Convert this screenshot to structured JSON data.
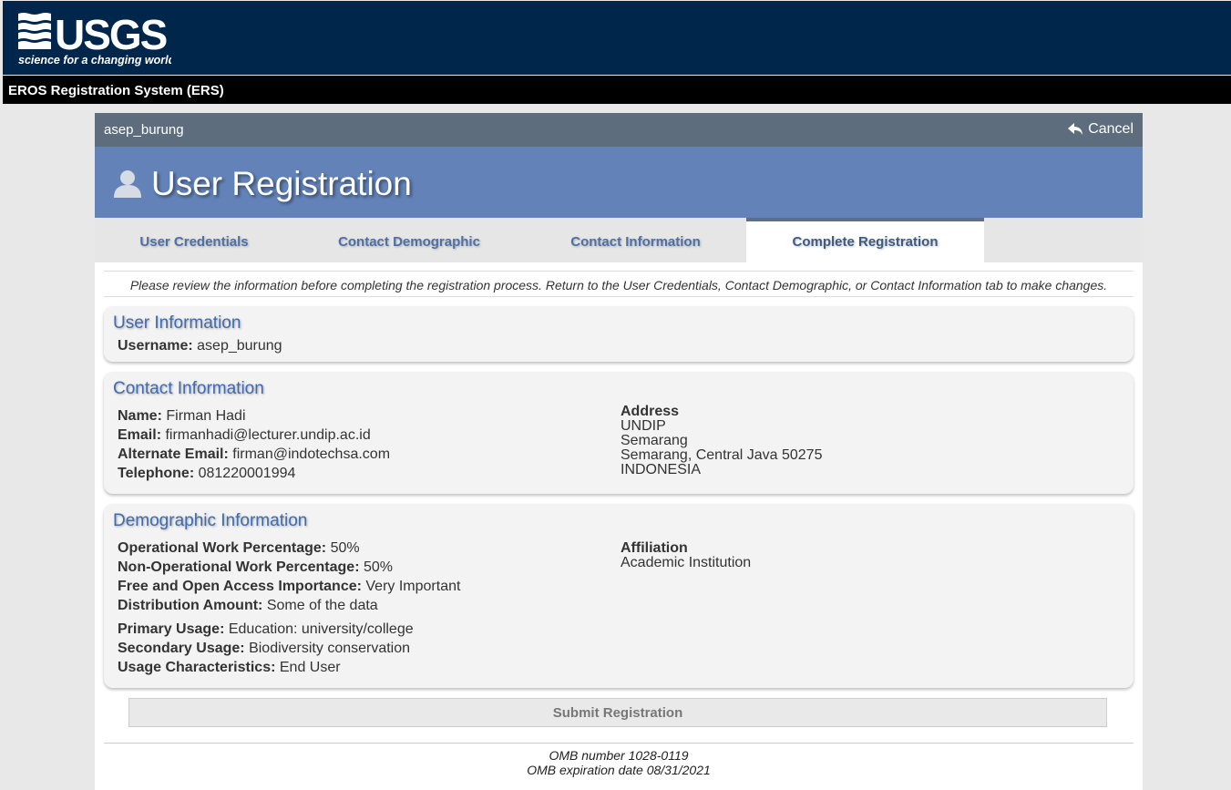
{
  "header": {
    "logo_text": "USGS",
    "logo_tagline": "science for a changing world",
    "system_name": "EROS Registration System (ERS)"
  },
  "user_strip": {
    "username": "asep_burung",
    "cancel_label": "Cancel"
  },
  "page_title": "User Registration",
  "tabs": [
    {
      "label": "User Credentials"
    },
    {
      "label": "Contact Demographic"
    },
    {
      "label": "Contact Information"
    },
    {
      "label": "Complete Registration"
    }
  ],
  "notice": "Please review the information before completing the registration process. Return to the User Credentials, Contact Demographic, or Contact Information tab to make changes.",
  "user_info": {
    "title": "User Information",
    "username_label": "Username:",
    "username": "asep_burung"
  },
  "contact_info": {
    "title": "Contact Information",
    "name_label": "Name:",
    "name": "Firman Hadi",
    "email_label": "Email:",
    "email": "firmanhadi@lecturer.undip.ac.id",
    "alt_email_label": "Alternate Email:",
    "alt_email": "firman@indotechsa.com",
    "telephone_label": "Telephone:",
    "telephone": "081220001994",
    "address_label": "Address",
    "address_line1": "UNDIP",
    "address_line2": "Semarang",
    "address_line3": "Semarang, Central Java 50275",
    "address_line4": "INDONESIA"
  },
  "demographic_info": {
    "title": "Demographic Information",
    "op_label": "Operational Work Percentage:",
    "op_value": "50%",
    "nonop_label": "Non-Operational Work Percentage:",
    "nonop_value": "50%",
    "foi_label": "Free and Open Access Importance:",
    "foi_value": "Very Important",
    "dist_label": "Distribution Amount:",
    "dist_value": "Some of the data",
    "primary_label": "Primary Usage:",
    "primary_value": "Education: university/college",
    "secondary_label": "Secondary Usage:",
    "secondary_value": "Biodiversity conservation",
    "usage_char_label": "Usage Characteristics:",
    "usage_char_value": "End User",
    "affiliation_label": "Affiliation",
    "affiliation_value": "Academic Institution"
  },
  "submit_label": "Submit Registration",
  "omb_number": "OMB number 1028-0119",
  "omb_expiration": "OMB expiration date 08/31/2021",
  "colors": {
    "header_bg": "#00264c",
    "title_bar": "#6282b8",
    "accent_text": "#3d6cb0"
  }
}
